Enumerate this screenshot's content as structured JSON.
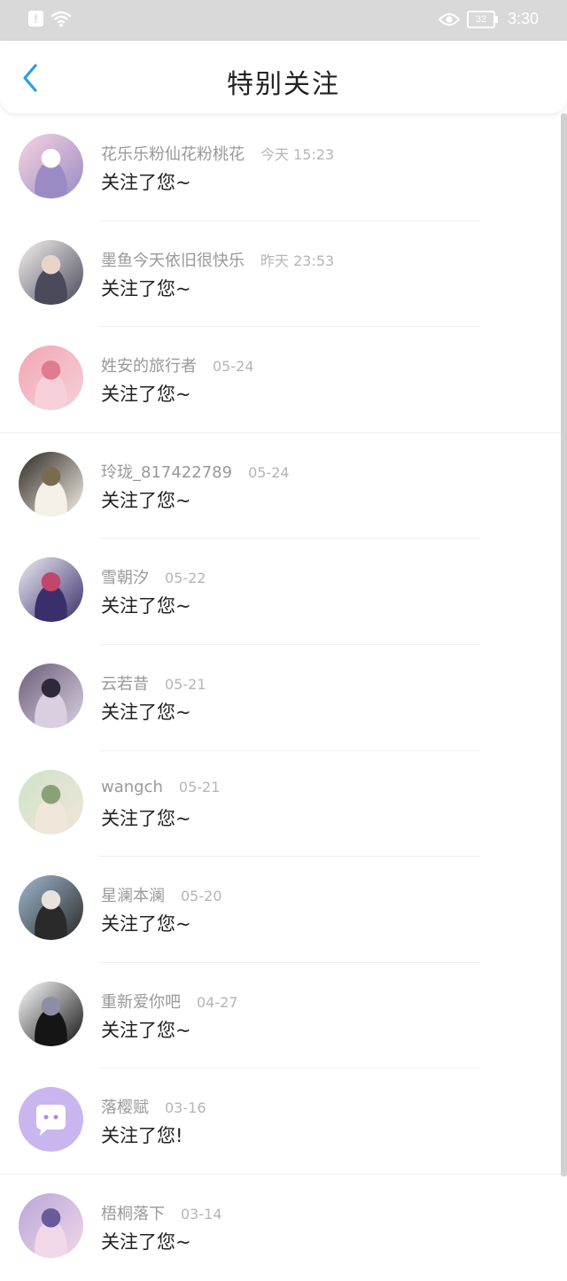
{
  "status_bar": {
    "battery": "32",
    "time": "3:30"
  },
  "header": {
    "title": "特别关注"
  },
  "items": [
    {
      "name": "花乐乐粉仙花粉桃花",
      "time": "今天 15:23",
      "message": "关注了您~",
      "avatar": {
        "c1": "#f6d3df",
        "c2": "#9b8bc4",
        "c3": "#ffffff"
      }
    },
    {
      "name": "墨鱼今天依旧很快乐",
      "time": "昨天 23:53",
      "message": "关注了您~",
      "avatar": {
        "c1": "#f5f2ef",
        "c2": "#4a4a5a",
        "c3": "#e8d5c8"
      }
    },
    {
      "name": "姓安的旅行者",
      "time": "05-24",
      "message": "关注了您~",
      "avatar": {
        "c1": "#f1a7b4",
        "c2": "#f6d0d8",
        "c3": "#e07b8f"
      }
    },
    {
      "name": "玲珑_817422789",
      "time": "05-24",
      "message": "关注了您~",
      "avatar": {
        "c1": "#2e2a25",
        "c2": "#f5f1e6",
        "c3": "#7a6a4f"
      }
    },
    {
      "name": "雪朝汐",
      "time": "05-22",
      "message": "关注了您~",
      "avatar": {
        "c1": "#ececf3",
        "c2": "#3b2f6b",
        "c3": "#c2466b"
      }
    },
    {
      "name": "云若昔",
      "time": "05-21",
      "message": "关注了您~",
      "avatar": {
        "c1": "#6b5f7a",
        "c2": "#d9cfe0",
        "c3": "#2f2838"
      }
    },
    {
      "name": "wangch",
      "time": "05-21",
      "message": "关注了您~",
      "avatar": {
        "c1": "#cfe2c7",
        "c2": "#f0e6da",
        "c3": "#8aa178"
      }
    },
    {
      "name": "星澜本澜",
      "time": "05-20",
      "message": "关注了您~",
      "avatar": {
        "c1": "#9fb8cf",
        "c2": "#2a2a2a",
        "c3": "#e8e2dc"
      }
    },
    {
      "name": "重新爱你吧",
      "time": "04-27",
      "message": "关注了您~",
      "avatar": {
        "c1": "#ffffff",
        "c2": "#151515",
        "c3": "#8d8da8"
      }
    },
    {
      "name": "落樱赋",
      "time": "03-16",
      "message": "关注了您!",
      "avatar": {
        "c1": "#c9b6ef",
        "c2": "#ffffff",
        "c3": "#a88ae0"
      }
    },
    {
      "name": "梧桐落下",
      "time": "03-14",
      "message": "关注了您~",
      "avatar": {
        "c1": "#b9a6d9",
        "c2": "#f0d8e8",
        "c3": "#6a5a9a"
      }
    }
  ]
}
